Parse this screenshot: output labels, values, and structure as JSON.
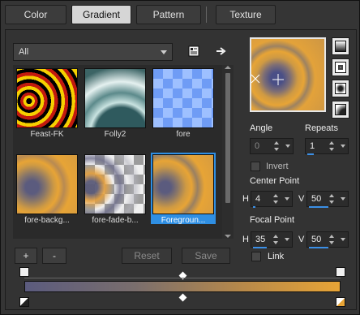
{
  "tabs": [
    {
      "label": "Color",
      "active": false
    },
    {
      "label": "Gradient",
      "active": true
    },
    {
      "label": "Pattern",
      "active": false
    },
    {
      "label": "Texture",
      "active": false
    }
  ],
  "filter": {
    "value": "All"
  },
  "thumbnails": [
    {
      "label": "Feast-FK",
      "icon": "feast-fk-gradient"
    },
    {
      "label": "Folly2",
      "icon": "folly2-gradient"
    },
    {
      "label": "fore",
      "icon": "fore-gradient"
    },
    {
      "label": "fore-backg...",
      "icon": "fore-background-gradient"
    },
    {
      "label": "fore-fade-b...",
      "icon": "fore-fade-gradient"
    },
    {
      "label": "Foregroun...",
      "icon": "foreground-gradient",
      "selected": true
    }
  ],
  "buttons": {
    "add": "+",
    "remove": "-",
    "reset": "Reset",
    "save": "Save"
  },
  "angle": {
    "label": "Angle",
    "value": "0"
  },
  "repeats": {
    "label": "Repeats",
    "value": "1"
  },
  "invert": {
    "label": "Invert",
    "checked": false
  },
  "center_point": {
    "label": "Center Point",
    "h_label": "H",
    "h_value": "4",
    "v_label": "V",
    "v_value": "50"
  },
  "focal_point": {
    "label": "Focal Point",
    "h_label": "H",
    "h_value": "35",
    "v_label": "V",
    "v_value": "50"
  },
  "link": {
    "label": "Link",
    "checked": false
  },
  "colors": {
    "accent": "#2f8fe3",
    "gold": "#e7a436",
    "slate": "#5b5b7e"
  }
}
